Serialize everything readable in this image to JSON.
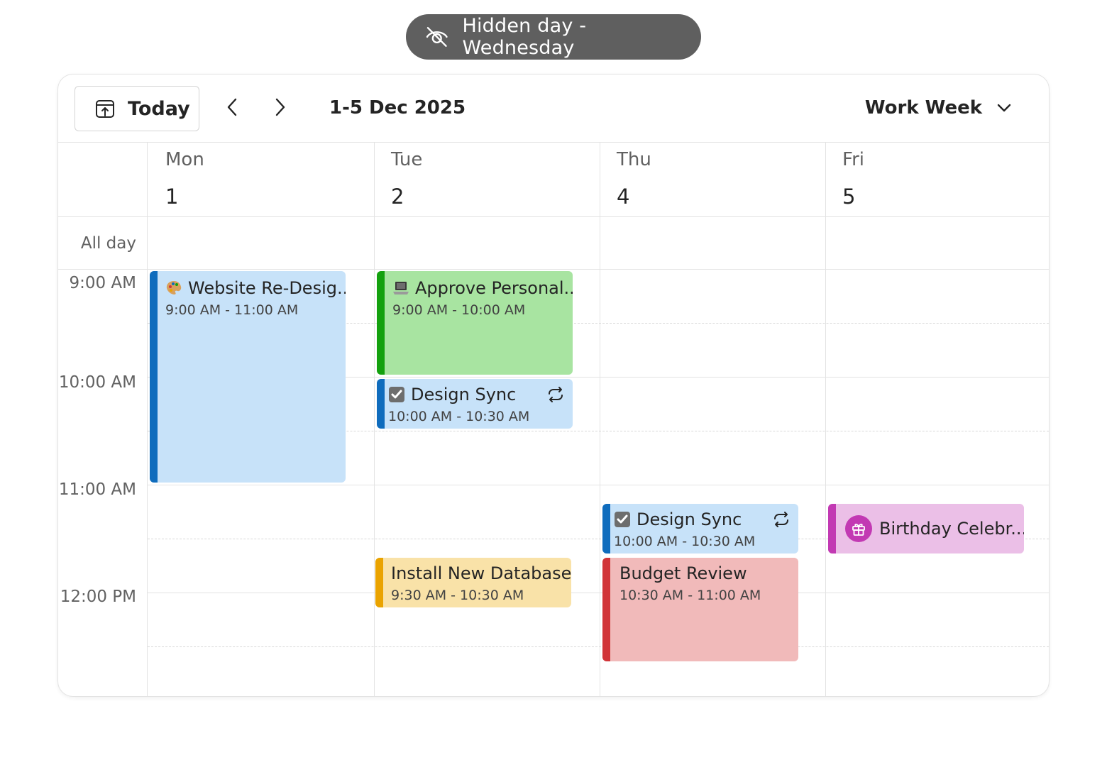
{
  "banner": {
    "label": "Hidden day - Wednesday",
    "icon": "eye-off-icon"
  },
  "toolbar": {
    "today_label": "Today",
    "today_icon": "calendar-today-icon",
    "prev_icon": "chevron-left-icon",
    "next_icon": "chevron-right-icon",
    "range": "1-5 Dec 2025",
    "view": "Work Week",
    "view_icon": "chevron-down-icon"
  },
  "columns": [
    {
      "name": "Mon",
      "date": "1"
    },
    {
      "name": "Tue",
      "date": "2"
    },
    {
      "name": "Thu",
      "date": "4"
    },
    {
      "name": "Fri",
      "date": "5"
    }
  ],
  "allday_label": "All day",
  "times": [
    "9:00 AM",
    "10:00 AM",
    "11:00 AM",
    "12:00 PM"
  ],
  "events": [
    {
      "title": "Website Re-Desig...",
      "time": "9:00 AM - 11:00 AM",
      "icon": "palette-icon",
      "accent": "#0f6cbd",
      "bg": "#c7e2f9"
    },
    {
      "title": "Approve Personal...",
      "time": "9:00 AM - 10:00 AM",
      "icon": "laptop-icon",
      "accent": "#13a10e",
      "bg": "#a8e4a1"
    },
    {
      "title": "Design Sync",
      "time": "10:00 AM - 10:30 AM",
      "icon": "checkbox-icon",
      "accent": "#0f6cbd",
      "bg": "#c7e2f9",
      "recurring": true
    },
    {
      "title": "Install New Database",
      "time": "9:30 AM - 10:30 AM",
      "accent": "#eaa300",
      "bg": "#f9e2a8"
    },
    {
      "title": "Design Sync",
      "time": "10:00 AM - 10:30 AM",
      "icon": "checkbox-icon",
      "accent": "#0f6cbd",
      "bg": "#c7e2f9",
      "recurring": true
    },
    {
      "title": "Budget Review",
      "time": "10:30 AM - 11:00 AM",
      "accent": "#d13438",
      "bg": "#f1baba"
    },
    {
      "title": "Birthday Celebr...",
      "icon": "gift-icon",
      "accent": "#c239b3",
      "bg": "#ebbfe7"
    }
  ]
}
